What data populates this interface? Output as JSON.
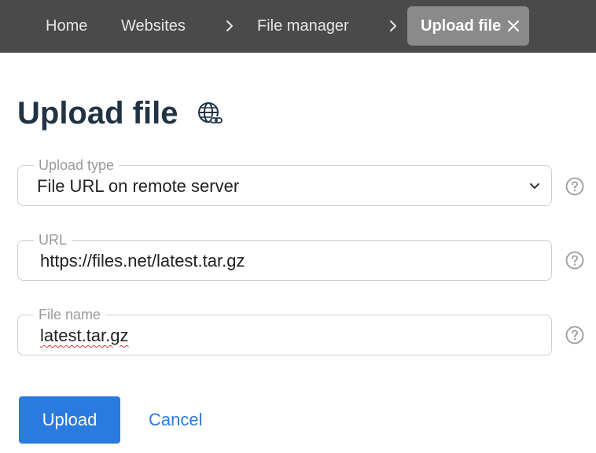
{
  "nav": {
    "breadcrumbs": [
      {
        "label": "Home"
      },
      {
        "label": "Websites"
      },
      {
        "label": "File manager"
      }
    ],
    "active_tab": {
      "label": "Upload file"
    }
  },
  "page": {
    "title": "Upload file"
  },
  "form": {
    "upload_type": {
      "legend": "Upload type",
      "value": "File URL on remote server"
    },
    "url": {
      "legend": "URL",
      "value": "https://files.net/latest.tar.gz"
    },
    "file_name": {
      "legend": "File name",
      "value": "latest.tar.gz"
    }
  },
  "actions": {
    "upload_label": "Upload",
    "cancel_label": "Cancel"
  },
  "colors": {
    "topbar_bg": "#4a4a4a",
    "active_tab_bg": "#8a8a8a",
    "title_color": "#1f3344",
    "primary": "#2a7be0",
    "legend": "#9a9a9a",
    "border": "#cfcfcf"
  },
  "icons": {
    "chevron": "chevron-right-icon",
    "close": "close-icon",
    "globe": "globe-link-icon",
    "select": "chevron-down-icon",
    "help": "help-circle-icon"
  }
}
